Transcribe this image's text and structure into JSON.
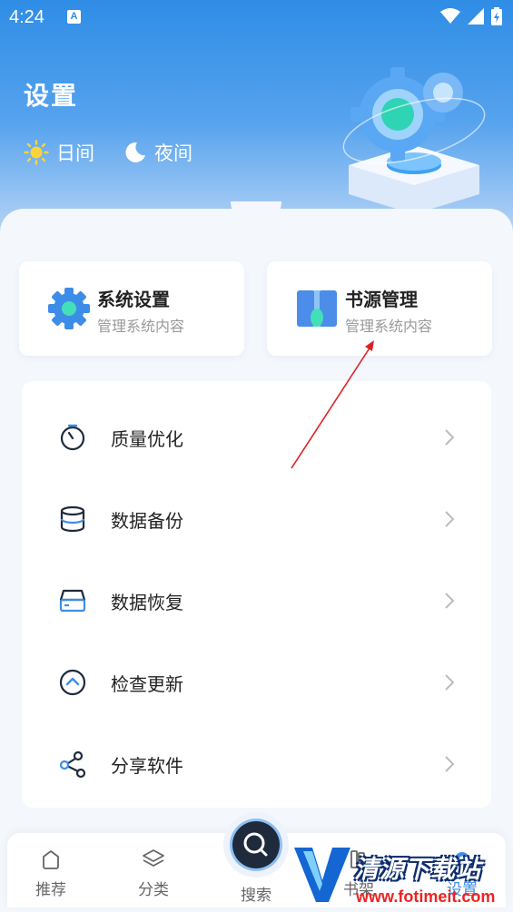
{
  "status_bar": {
    "time": "4:24",
    "app_icon_letter": "A"
  },
  "header": {
    "title": "设置",
    "modes": [
      {
        "label": "日间",
        "icon": "sun-icon"
      },
      {
        "label": "夜间",
        "icon": "moon-icon"
      }
    ]
  },
  "cards": [
    {
      "title": "系统设置",
      "subtitle": "管理系统内容",
      "icon": "gear-icon"
    },
    {
      "title": "书源管理",
      "subtitle": "管理系统内容",
      "icon": "book-icon"
    }
  ],
  "menu": [
    {
      "label": "质量优化",
      "icon": "timer-icon"
    },
    {
      "label": "数据备份",
      "icon": "database-icon"
    },
    {
      "label": "数据恢复",
      "icon": "drive-icon"
    },
    {
      "label": "检查更新",
      "icon": "up-circle-icon"
    },
    {
      "label": "分享软件",
      "icon": "share-icon"
    }
  ],
  "bottom_nav": [
    {
      "label": "推荐",
      "icon": "home-icon"
    },
    {
      "label": "分类",
      "icon": "layers-icon"
    },
    {
      "label": "搜索",
      "icon": "search-icon"
    },
    {
      "label": "书架",
      "icon": "bookshelf-icon"
    },
    {
      "label": "设置",
      "icon": "settings-icon"
    }
  ],
  "watermark": {
    "text": "清源下载站",
    "url": "www.fotimeit.com"
  },
  "colors": {
    "accent": "#2f8de6",
    "annotation": "#e02020"
  }
}
